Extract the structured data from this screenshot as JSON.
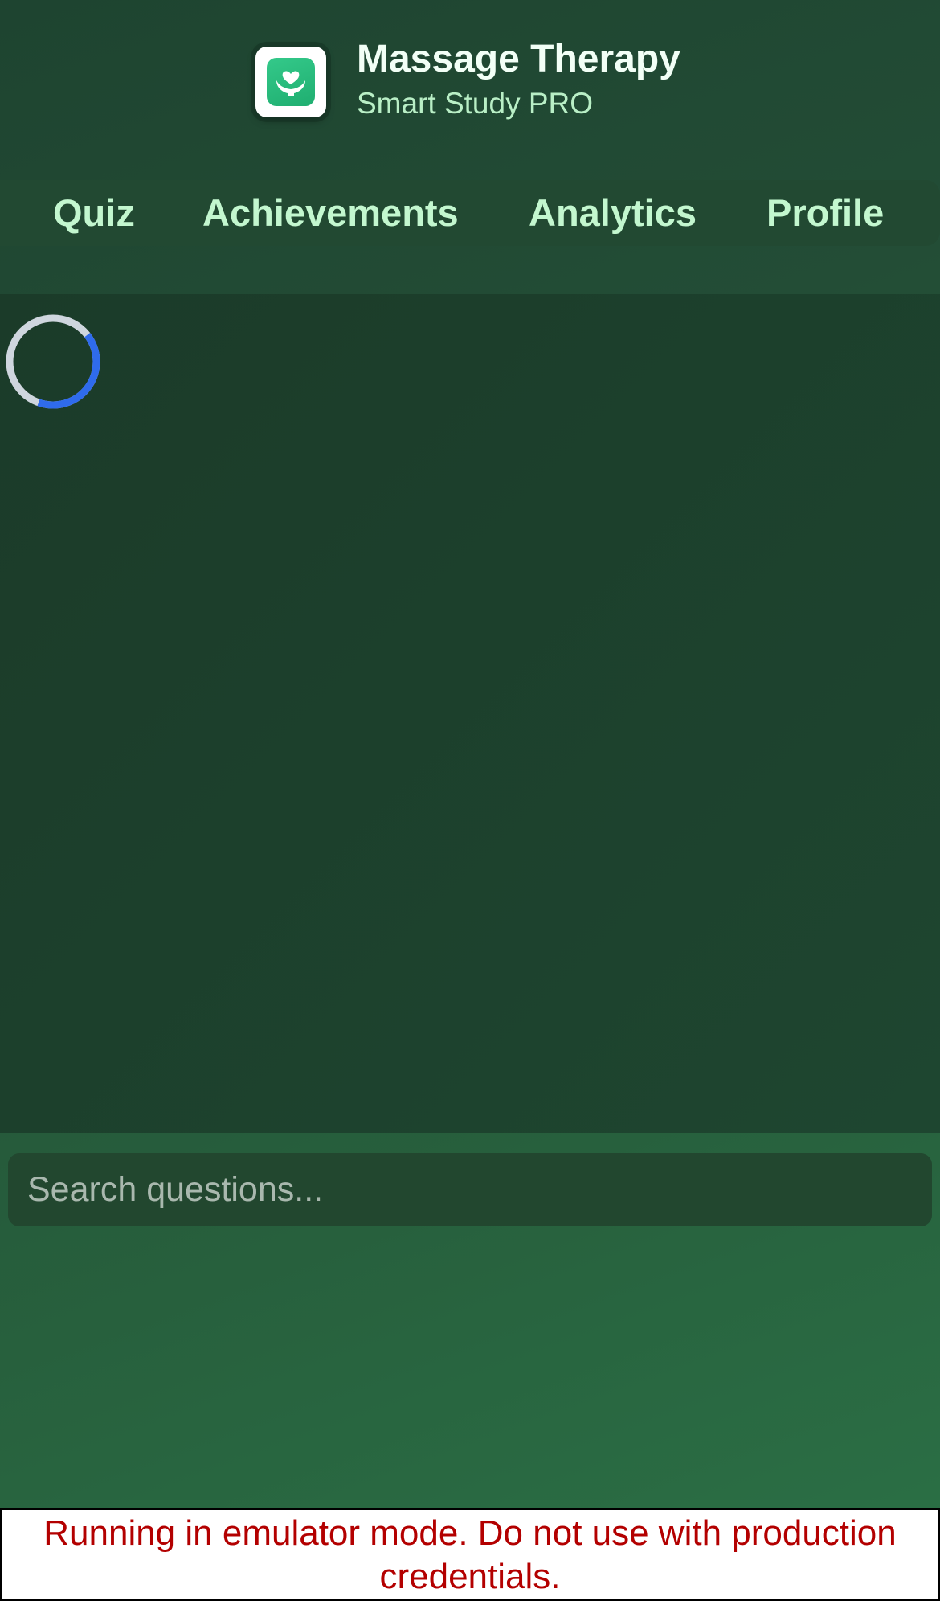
{
  "app": {
    "icon": "heart-hands-icon",
    "title": "Massage Therapy",
    "subtitle": "Smart Study PRO"
  },
  "nav": {
    "items": [
      {
        "label": "Quiz"
      },
      {
        "label": "Achievements"
      },
      {
        "label": "Analytics"
      },
      {
        "label": "Profile"
      }
    ]
  },
  "content": {
    "state": "loading",
    "spinner_icon": "loading-spinner-icon"
  },
  "search": {
    "placeholder": "Search questions...",
    "value": ""
  },
  "banner": {
    "text": "Running in emulator mode. Do not use with production credentials."
  },
  "colors": {
    "background_dark": "#1e4430",
    "background_light": "#2b7146",
    "title_text": "#f2fff6",
    "subtitle_text": "#b9efc6",
    "nav_text": "#c3f7cf",
    "spinner_track": "#cfd6de",
    "spinner_accent": "#2f6bec",
    "app_icon_green": "#2bbd7e",
    "banner_text": "#b30000"
  }
}
